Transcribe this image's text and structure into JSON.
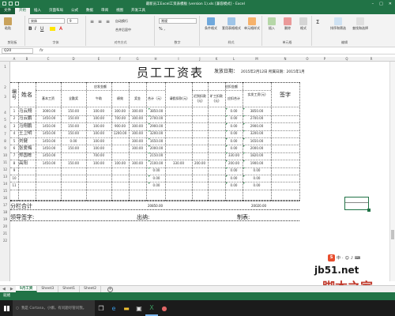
{
  "window": {
    "title": "最新员工Excel工资表模板 (version 1).xls [兼容模式] - Excel"
  },
  "ribbon_tabs": [
    "文件",
    "开始",
    "插入",
    "页面布局",
    "公式",
    "数据",
    "审阅",
    "视图",
    "开发工具"
  ],
  "active_tab": "开始",
  "ribbon": {
    "paste": "粘贴",
    "clipboard": "剪贴板",
    "font_name": "宋体",
    "font_size": "9",
    "font_group": "字体",
    "align_group": "对齐方式",
    "wrap_text": "自动换行",
    "merge_center": "合并后居中",
    "number_format": "常规",
    "number_group": "数字",
    "conditional_format": "条件格式",
    "table_format": "套用表格格式",
    "cell_styles": "单元格样式",
    "styles_group": "样式",
    "insert_cells": "插入",
    "delete_cells": "删除",
    "format_cells": "格式",
    "cells_group": "单元格",
    "sort_filter": "排序和筛选",
    "find_select": "查找和选择",
    "editing_group": "编辑"
  },
  "formula_bar": {
    "name_box": "Q20",
    "fx": "fx",
    "content": ""
  },
  "column_headers": [
    "A",
    "B",
    "C",
    "D",
    "E",
    "F",
    "G",
    "H",
    "I",
    "J",
    "K",
    "L",
    "M",
    "N",
    "O",
    "P",
    "Q",
    "R"
  ],
  "row_headers": [
    "1",
    "2",
    "3",
    "4",
    "5",
    "6",
    "7",
    "8",
    "9",
    "10",
    "11",
    "12",
    "13",
    "14",
    "15",
    "16",
    "17",
    "18",
    "19",
    "20",
    "21",
    "22"
  ],
  "document": {
    "title": "员工工资表",
    "issue_label": "发放日期：",
    "issue_date": "2015年2月12日  所属日期：2015年1月",
    "header": {
      "col_no": "编号",
      "col_name": "姓名",
      "group_payable": "应发金额",
      "group_deduct": "应扣金额",
      "col_base": "基本工资",
      "col_allowance": "全勤奖",
      "col_lunch": "午助",
      "col_perf": "绩效",
      "col_bonus": "奖金",
      "col_total": "合计（元）",
      "col_sick": "请假扣款(元)",
      "col_late": "迟到扣款(元)",
      "col_absent": "旷工扣款(元)",
      "col_deduct_total": "应扣合计",
      "col_net": "实发工资(元)",
      "col_sign": "签字"
    },
    "rows": [
      {
        "no": "1",
        "name": "马云翔",
        "base": "3000.00",
        "allow": "150.00",
        "lunch": "100.00",
        "perf": "300.00",
        "bonus": "300.00",
        "total": "3850.00",
        "sick": "",
        "late": "",
        "absent": "",
        "deduct": "0.00",
        "net": "3850.00"
      },
      {
        "no": "2",
        "name": "马云鹏",
        "base": "1450.00",
        "allow": "150.00",
        "lunch": "100.00",
        "perf": "700.00",
        "bonus": "300.00",
        "total": "2700.00",
        "sick": "",
        "late": "",
        "absent": "",
        "deduct": "0.00",
        "net": "2700.00"
      },
      {
        "no": "3",
        "name": "马翔鹏",
        "base": "1450.00",
        "allow": "150.00",
        "lunch": "100.00",
        "perf": "900.00",
        "bonus": "300.00",
        "total": "2900.00",
        "sick": "",
        "late": "",
        "absent": "",
        "deduct": "0.00",
        "net": "2900.00"
      },
      {
        "no": "4",
        "name": "王卫明",
        "base": "1450.00",
        "allow": "150.00",
        "lunch": "100.00",
        "perf": "1200.00",
        "bonus": "300.00",
        "total": "3200.00",
        "sick": "",
        "late": "",
        "absent": "",
        "deduct": "0.00",
        "net": "3200.00"
      },
      {
        "no": "5",
        "name": "刘健",
        "base": "1450.00",
        "allow": "0.00",
        "lunch": "100.00",
        "perf": "",
        "bonus": "300.00",
        "total": "1650.00",
        "sick": "",
        "late": "",
        "absent": "",
        "deduct": "0.00",
        "net": "1650.00"
      },
      {
        "no": "6",
        "name": "张爱梅",
        "base": "1450.00",
        "allow": "150.00",
        "lunch": "100.00",
        "perf": "",
        "bonus": "300.00",
        "total": "2000.00",
        "sick": "",
        "late": "",
        "absent": "",
        "deduct": "0.00",
        "net": "2000.00"
      },
      {
        "no": "7",
        "name": "郑国栋",
        "base": "1450.00",
        "allow": "",
        "lunch": "700.00",
        "perf": "",
        "bonus": "",
        "total": "2150.00",
        "sick": "",
        "late": "",
        "absent": "",
        "deduct": "330.00",
        "net": "1820.00"
      },
      {
        "no": "8",
        "name": "高阳",
        "base": "1450.00",
        "allow": "150.00",
        "lunch": "100.00",
        "perf": "100.00",
        "bonus": "300.00",
        "total": "2100.00",
        "sick": "330.00",
        "late": "200.00",
        "absent": "",
        "deduct": "200.00",
        "net": "1900.00"
      },
      {
        "no": "9",
        "name": "",
        "base": "",
        "allow": "",
        "lunch": "",
        "perf": "",
        "bonus": "",
        "total": "0.00",
        "sick": "",
        "late": "",
        "absent": "",
        "deduct": "0.00",
        "net": "0.00"
      },
      {
        "no": "10",
        "name": "",
        "base": "",
        "allow": "",
        "lunch": "",
        "perf": "",
        "bonus": "",
        "total": "0.00",
        "sick": "",
        "late": "",
        "absent": "",
        "deduct": "0.00",
        "net": "0.00"
      },
      {
        "no": "11",
        "name": "",
        "base": "",
        "allow": "",
        "lunch": "",
        "perf": "",
        "bonus": "",
        "total": "0.00",
        "sick": "",
        "late": "",
        "absent": "",
        "deduct": "0.00",
        "net": "0.00"
      }
    ],
    "subtotal_label": "分栏合计",
    "subtotal_total": "20850.00",
    "subtotal_net": "20020.00",
    "leader_sign": "领导签字:",
    "cashier": "出纳:",
    "preparer": "制表:"
  },
  "sheet_tabs": [
    "5月工资",
    "Sheet3",
    "Sheet1",
    "Sheet2"
  ],
  "active_sheet": "5月工资",
  "status": "就绪",
  "taskbar": {
    "search_placeholder": "我是 Cortana，小娜。有问题尽管问我。"
  },
  "watermark": {
    "site": "jb51.net",
    "cn": "脚本之家"
  },
  "colors": {
    "excel_green": "#217346",
    "taskbar": "#1b1b1b",
    "watermark_red": "#c0392b"
  }
}
